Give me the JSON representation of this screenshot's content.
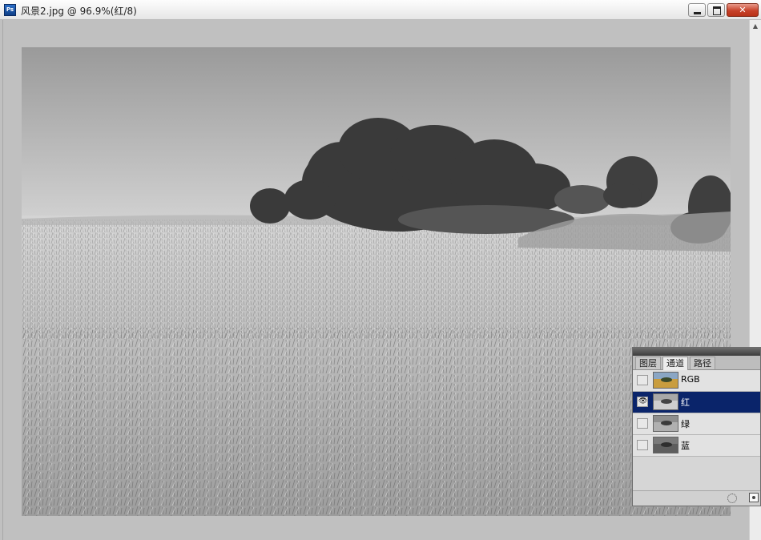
{
  "window": {
    "app_icon": "Ps",
    "title": "风景2.jpg @ 96.9%(红/8)"
  },
  "channels_panel": {
    "tabs": [
      {
        "label": "图层",
        "active": false
      },
      {
        "label": "通道",
        "active": true
      },
      {
        "label": "路径",
        "active": false
      }
    ],
    "channels": [
      {
        "name": "RGB",
        "visible": false,
        "selected": false,
        "thumb": "color"
      },
      {
        "name": "红",
        "visible": true,
        "selected": true,
        "thumb": "light-gray"
      },
      {
        "name": "绿",
        "visible": false,
        "selected": false,
        "thumb": "gray"
      },
      {
        "name": "蓝",
        "visible": false,
        "selected": false,
        "thumb": "dark-gray"
      }
    ],
    "selected_color": "#0a246a"
  },
  "icons": {
    "eye": "eye-icon",
    "load_selection": "dotted-circle-icon",
    "save_mask": "mask-icon"
  }
}
